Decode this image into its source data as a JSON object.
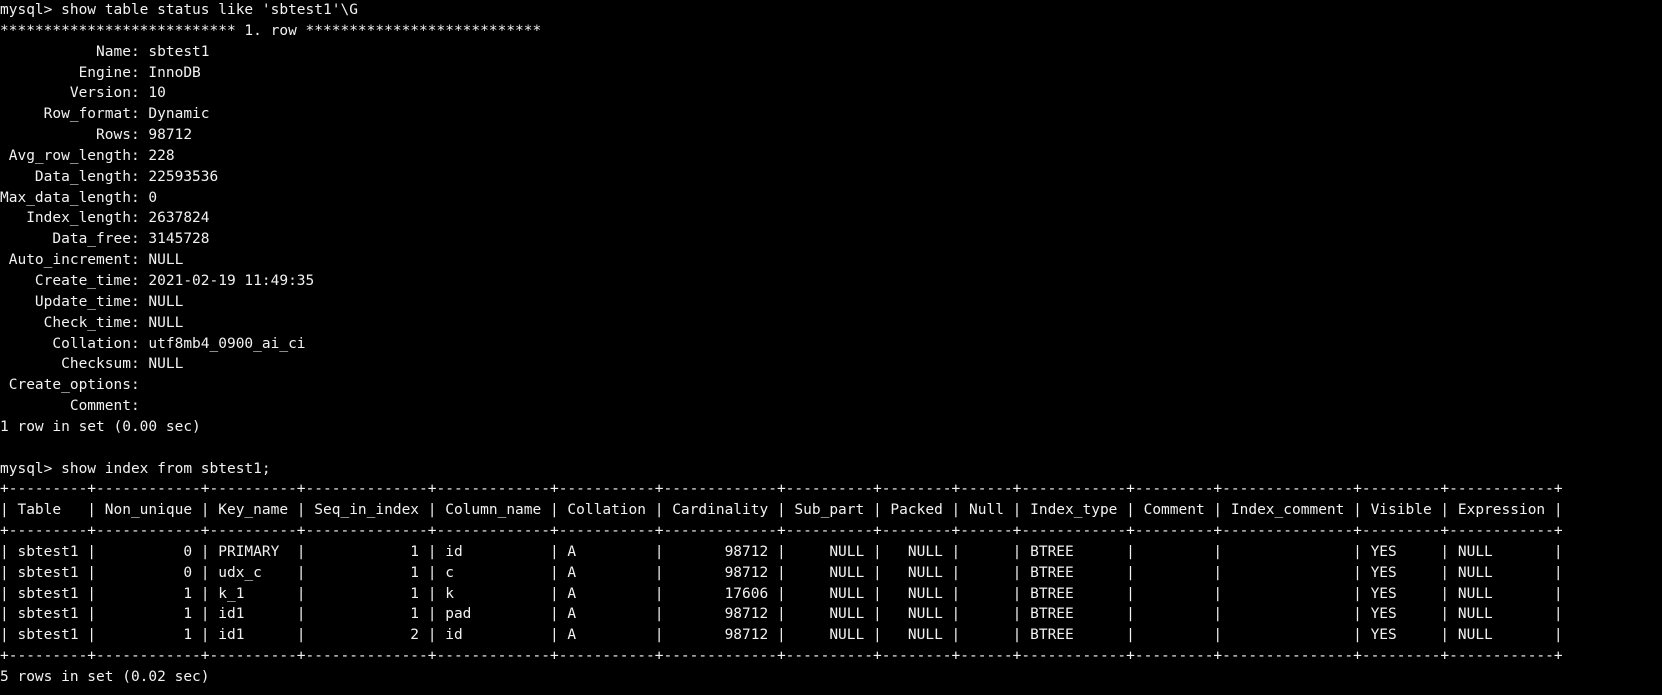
{
  "terminal": {
    "lines": [
      "mysql> show table status like 'sbtest1'\\G",
      "*************************** 1. row ***************************",
      "           Name: sbtest1",
      "         Engine: InnoDB",
      "        Version: 10",
      "     Row_format: Dynamic",
      "           Rows: 98712",
      " Avg_row_length: 228",
      "    Data_length: 22593536",
      "Max_data_length: 0",
      "   Index_length: 2637824",
      "      Data_free: 3145728",
      " Auto_increment: NULL",
      "    Create_time: 2021-02-19 11:49:35",
      "    Update_time: NULL",
      "     Check_time: NULL",
      "      Collation: utf8mb4_0900_ai_ci",
      "       Checksum: NULL",
      " Create_options: ",
      "        Comment: ",
      "1 row in set (0.00 sec)",
      "",
      "mysql> show index from sbtest1;",
      "+---------+------------+----------+--------------+-------------+-----------+-------------+----------+--------+------+------------+---------+---------------+---------+------------+",
      "| Table   | Non_unique | Key_name | Seq_in_index | Column_name | Collation | Cardinality | Sub_part | Packed | Null | Index_type | Comment | Index_comment | Visible | Expression |",
      "+---------+------------+----------+--------------+-------------+-----------+-------------+----------+--------+------+------------+---------+---------------+---------+------------+",
      "| sbtest1 |          0 | PRIMARY  |            1 | id          | A         |       98712 |     NULL |   NULL |      | BTREE      |         |               | YES     | NULL       |",
      "| sbtest1 |          0 | udx_c    |            1 | c           | A         |       98712 |     NULL |   NULL |      | BTREE      |         |               | YES     | NULL       |",
      "| sbtest1 |          1 | k_1      |            1 | k           | A         |       17606 |     NULL |   NULL |      | BTREE      |         |               | YES     | NULL       |",
      "| sbtest1 |          1 | id1      |            1 | pad         | A         |       98712 |     NULL |   NULL |      | BTREE      |         |               | YES     | NULL       |",
      "| sbtest1 |          1 | id1      |            2 | id          | A         |       98712 |     NULL |   NULL |      | BTREE      |         |               | YES     | NULL       |",
      "+---------+------------+----------+--------------+-------------+-----------+-------------+----------+--------+------+------------+---------+---------------+---------+------------+",
      "5 rows in set (0.02 sec)"
    ]
  }
}
